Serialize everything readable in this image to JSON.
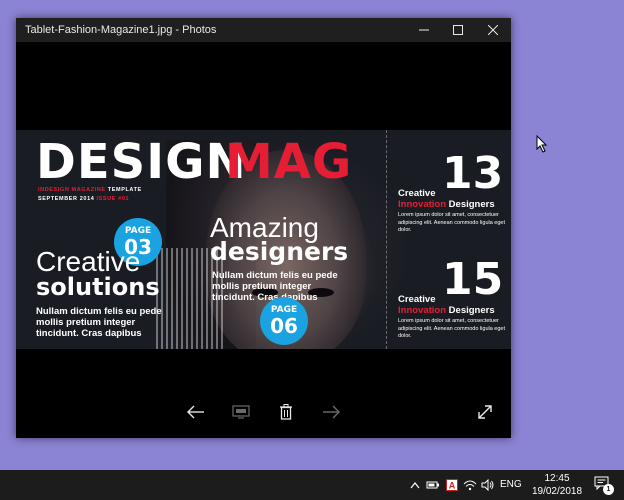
{
  "window": {
    "title": "Tablet-Fashion-Magazine1.jpg - Photos"
  },
  "magazine": {
    "brand_part1": "DESIGN",
    "brand_part2": "MAG",
    "tagline_line1_red": "INDESIGN MAGAZINE",
    "tagline_line1_white": " TEMPLATE",
    "tagline_line2_white": "SEPTEMBER 2014 ",
    "tagline_line2_red": "ISSUE #01",
    "badge1_label": "PAGE",
    "badge1_number": "03",
    "badge2_label": "PAGE",
    "badge2_number": "06",
    "headline_left_light": "Creative",
    "headline_left_bold": "solutions",
    "blurb_left": "Nullam dictum felis eu pede mollis pretium integer tincidunt. Cras dapibus",
    "headline_center_light": "Amazing",
    "headline_center_bold": "designers",
    "blurb_center": "Nullam dictum felis eu pede mollis pretium integer tincidunt. Cras dapibus",
    "side1_number": "13",
    "side1_title_white": "Creative",
    "side1_title_red": "Innovation",
    "side1_title_end": " Designers",
    "side1_body": "Lorem ipsum dolor sit amet, consectetuer adipiscing elit. Aenean commodo ligula eget dolor.",
    "side2_number": "15",
    "side2_title_white": "Creative",
    "side2_title_red": "Innovation",
    "side2_title_end": " Designers",
    "side2_body": "Lorem ipsum dolor sit amet, consectetuer adipiscing elit. Aenean commodo ligula eget dolor."
  },
  "toolbar": {
    "icons": [
      "back-arrow-icon",
      "slideshow-icon",
      "delete-icon",
      "forward-arrow-icon",
      "fullscreen-icon"
    ]
  },
  "taskbar": {
    "language": "ENG",
    "time": "12:45",
    "date": "19/02/2018",
    "notification_count": "1"
  },
  "colors": {
    "desktop": "#8b83d3",
    "accent_red": "#e61e35",
    "badge_blue": "#1aa3e0",
    "taskbar": "#1c1c1c"
  }
}
